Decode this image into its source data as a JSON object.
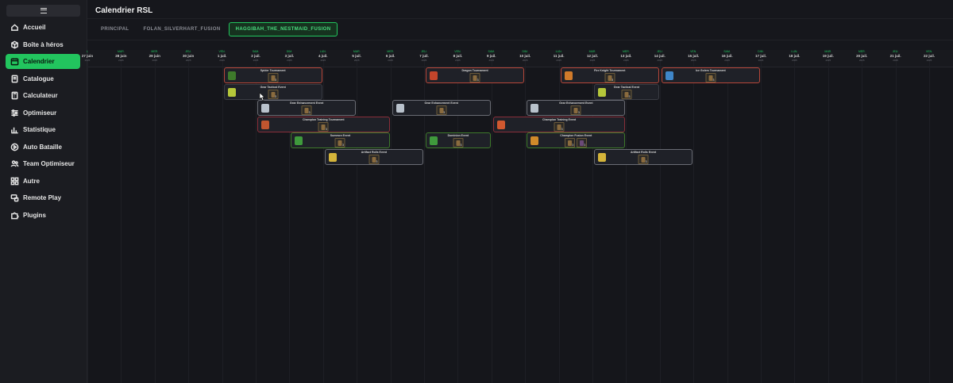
{
  "sidebar": {
    "items": [
      {
        "label": "Accueil",
        "icon": "home-icon",
        "active": false
      },
      {
        "label": "Boîte à héros",
        "icon": "box-icon",
        "active": false
      },
      {
        "label": "Calendrier",
        "icon": "calendar-icon",
        "active": true
      },
      {
        "label": "Catalogue",
        "icon": "book-icon",
        "active": false
      },
      {
        "label": "Calculateur",
        "icon": "calculator-icon",
        "active": false
      },
      {
        "label": "Optimiseur",
        "icon": "sliders-icon",
        "active": false
      },
      {
        "label": "Statistique",
        "icon": "bar-chart-icon",
        "active": false
      },
      {
        "label": "Auto Bataille",
        "icon": "play-circle-icon",
        "active": false
      },
      {
        "label": "Team Optimiseur",
        "icon": "users-icon",
        "active": false
      },
      {
        "label": "Autre",
        "icon": "grid-icon",
        "active": false
      },
      {
        "label": "Remote Play",
        "icon": "remote-icon",
        "active": false
      },
      {
        "label": "Plugins",
        "icon": "puzzle-icon",
        "active": false
      }
    ]
  },
  "header": {
    "title": "Calendrier RSL"
  },
  "tabs": [
    {
      "label": "PRINCIPAL",
      "active": false
    },
    {
      "label": "FOLAN_SILVERHART_FUSION",
      "active": false
    },
    {
      "label": "HAGGIBAH_THE_NESTMAID_FUSION",
      "active": true
    }
  ],
  "colors": {
    "accent": "#22c55e",
    "sidebar_bg": "#1b1c21",
    "page_bg": "#16171c"
  },
  "calendar": {
    "days": [
      {
        "dow": "L",
        "date": "27 juin",
        "yr": "2025"
      },
      {
        "dow": "MAR.",
        "date": "28 juin",
        "yr": "2025"
      },
      {
        "dow": "MER.",
        "date": "29 juin",
        "yr": "2025"
      },
      {
        "dow": "JEU.",
        "date": "30 juin",
        "yr": "2025"
      },
      {
        "dow": "VEN.",
        "date": "1 juil.",
        "yr": "2025"
      },
      {
        "dow": "SAM.",
        "date": "2 juil.",
        "yr": "2025"
      },
      {
        "dow": "DIM.",
        "date": "3 juil.",
        "yr": "2025"
      },
      {
        "dow": "LUN.",
        "date": "4 juil.",
        "yr": "2025"
      },
      {
        "dow": "MAR.",
        "date": "5 juil.",
        "yr": "2025"
      },
      {
        "dow": "MER.",
        "date": "6 juil.",
        "yr": "2025"
      },
      {
        "dow": "JEU.",
        "date": "7 juil.",
        "yr": "2025"
      },
      {
        "dow": "VEN.",
        "date": "8 juil.",
        "yr": "2025"
      },
      {
        "dow": "SAM.",
        "date": "9 juil.",
        "yr": "2025"
      },
      {
        "dow": "DIM.",
        "date": "10 juil.",
        "yr": "2025"
      },
      {
        "dow": "LUN.",
        "date": "11 juil.",
        "yr": "2025"
      },
      {
        "dow": "MAR.",
        "date": "12 juil.",
        "yr": "2025"
      },
      {
        "dow": "MER.",
        "date": "13 juil.",
        "yr": "2025"
      },
      {
        "dow": "JEU.",
        "date": "14 juil.",
        "yr": "2025"
      },
      {
        "dow": "VEN.",
        "date": "15 juil.",
        "yr": "2025"
      },
      {
        "dow": "SAM.",
        "date": "16 juil.",
        "yr": "2025"
      },
      {
        "dow": "DIM.",
        "date": "17 juil.",
        "yr": "2025"
      },
      {
        "dow": "LUN.",
        "date": "18 juil.",
        "yr": "2025"
      },
      {
        "dow": "MAR.",
        "date": "19 juil.",
        "yr": "2025"
      },
      {
        "dow": "MER.",
        "date": "20 juil.",
        "yr": "2025"
      },
      {
        "dow": "JEU.",
        "date": "21 juil.",
        "yr": "2025"
      },
      {
        "dow": "VEN.",
        "date": "22 juil.",
        "yr": "2025"
      }
    ],
    "events": [
      {
        "name": "Spider Tournament",
        "row": 0,
        "start": 4,
        "span": 3,
        "color": "#b7473a",
        "icon_color": "#3e7a2b",
        "champs": [
          "3"
        ]
      },
      {
        "name": "Dragon Tournament",
        "row": 0,
        "start": 10,
        "span": 3,
        "color": "#b7473a",
        "icon_color": "#c2452b",
        "champs": [
          "3"
        ]
      },
      {
        "name": "Fire Knight Tournament",
        "row": 0,
        "start": 14,
        "span": 3,
        "color": "#b7473a",
        "icon_color": "#d07a2a",
        "champs": [
          "3"
        ]
      },
      {
        "name": "Ice Golem Tournament",
        "row": 0,
        "start": 17,
        "span": 3,
        "color": "#b7473a",
        "icon_color": "#3f86c9",
        "champs": [
          "3"
        ]
      },
      {
        "name": "Gear Tactical Event",
        "row": 1,
        "start": 4,
        "span": 3,
        "color": "#3a3c44",
        "icon_color": "#b5c73a",
        "champs": [
          "3"
        ]
      },
      {
        "name": "Gear Tactical Event",
        "row": 1,
        "start": 15,
        "span": 2,
        "color": "#3a3c44",
        "icon_color": "#b5c73a",
        "champs": [
          "3"
        ]
      },
      {
        "name": "Gear Enhancement Event",
        "row": 2,
        "start": 5,
        "span": 3,
        "color": "#6a6c74",
        "icon_color": "#b9c2cc",
        "champs": [
          "3"
        ]
      },
      {
        "name": "Gear Enhancement Event",
        "row": 2,
        "start": 9,
        "span": 3,
        "color": "#6a6c74",
        "icon_color": "#b9c2cc",
        "champs": [
          "3"
        ]
      },
      {
        "name": "Gear Enhancement Event",
        "row": 2,
        "start": 13,
        "span": 3,
        "color": "#6a6c74",
        "icon_color": "#b9c2cc",
        "champs": [
          "3"
        ]
      },
      {
        "name": "Champion Training Tournament",
        "row": 3,
        "start": 5,
        "span": 4,
        "color": "#8a2f3a",
        "icon_color": "#c0552f",
        "champs": [
          "3"
        ]
      },
      {
        "name": "Champion Training Event",
        "row": 3,
        "start": 12,
        "span": 4,
        "color": "#8a2f3a",
        "icon_color": "#d0582f",
        "champs": [
          "3"
        ]
      },
      {
        "name": "Summon Event",
        "row": 4,
        "start": 6,
        "span": 3,
        "color": "#3e7a2b",
        "icon_color": "#3f9a3c",
        "champs": [
          "3"
        ]
      },
      {
        "name": "Dominion Event",
        "row": 4,
        "start": 10,
        "span": 2,
        "color": "#3e7a2b",
        "icon_color": "#3f9a3c",
        "champs": [
          "3"
        ]
      },
      {
        "name": "Champion Fusion Event",
        "row": 4,
        "start": 13,
        "span": 3,
        "color": "#3e7a2b",
        "icon_color": "#d08a2a",
        "champs": [
          "3",
          "3"
        ]
      },
      {
        "name": "Artifact Rolls Event",
        "row": 5,
        "start": 7,
        "span": 3,
        "color": "#6a6c74",
        "icon_color": "#d4b43a",
        "champs": [
          "3"
        ]
      },
      {
        "name": "Artifact Rolls Event",
        "row": 5,
        "start": 15,
        "span": 3,
        "color": "#6a6c74",
        "icon_color": "#d4b43a",
        "champs": [
          "3"
        ]
      }
    ]
  }
}
